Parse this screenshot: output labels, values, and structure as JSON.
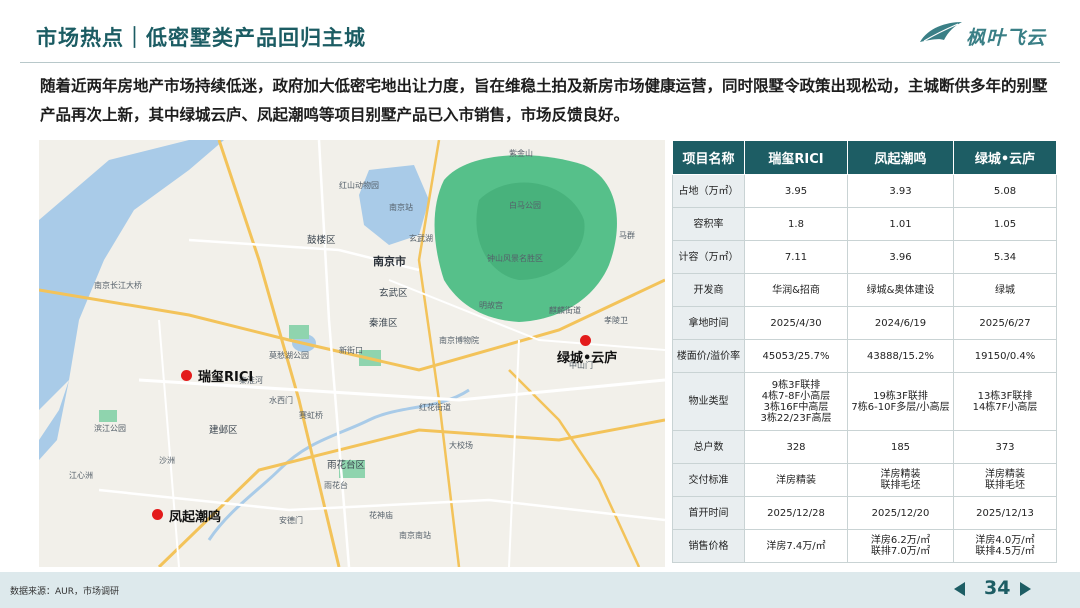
{
  "header": {
    "title": "市场热点｜低密墅类产品回归主城",
    "logo_text": "枫叶飞云"
  },
  "intro": {
    "text": "随着近两年房地产市场持续低迷，政府加大低密宅地出让力度，旨在维稳土拍及新房市场健康运营，同时限墅令政策出现松动，主城断供多年的别墅产品再次上新，其中绿城云庐、凤起潮鸣等项目别墅产品已入市销售，市场反馈良好。"
  },
  "map": {
    "pins": [
      {
        "label": "瑞玺RICI"
      },
      {
        "label": "绿城•云庐"
      },
      {
        "label": "凤起潮鸣"
      }
    ],
    "labels": {
      "nanjing_city": "南京市",
      "gulou": "鼓楼区",
      "xuanwu": "玄武区",
      "qinhuai": "秦淮区",
      "jianye": "建邺区",
      "yuhuatai": "雨花台区",
      "zhongshan": "钟山风景名胜区",
      "nanjing_station": "南京站",
      "nanjing_museum": "南京博物院",
      "xuanwu_lake": "玄武湖",
      "qixia": "麒麟街道",
      "hexi": "滨江公园",
      "zhongshan_gate": "中山门",
      "yuhua_park": "雨花台",
      "nanjing_south": "南京南站",
      "changjiang_bridge": "南京长江大桥",
      "mochou": "莫愁湖公园",
      "zijin": "紫金山",
      "ming_palace": "明故宫",
      "xinjiekou": "新街口",
      "ruanjian": "红花街道",
      "dajiaochang": "大校场",
      "jiangxinzhou": "江心洲",
      "qinhuai_river": "秦淮河",
      "baima": "白马公园",
      "hongshan": "红山动物园",
      "shuiximen": "水西门",
      "xiaolingwei": "孝陵卫",
      "maqun": "马群",
      "shazhou": "沙洲",
      "andemen": "安德门",
      "saihongqiao": "赛虹桥",
      "huashen": "花神庙"
    }
  },
  "table": {
    "header": [
      "项目名称",
      "瑞玺RICI",
      "凤起潮鸣",
      "绿城•云庐"
    ],
    "rows": [
      {
        "label": "占地（万㎡）",
        "cells": [
          [
            "3.95"
          ],
          [
            "3.93"
          ],
          [
            "5.08"
          ]
        ]
      },
      {
        "label": "容积率",
        "cells": [
          [
            "1.8"
          ],
          [
            "1.01"
          ],
          [
            "1.05"
          ]
        ]
      },
      {
        "label": "计容（万㎡）",
        "cells": [
          [
            "7.11"
          ],
          [
            "3.96"
          ],
          [
            "5.34"
          ]
        ]
      },
      {
        "label": "开发商",
        "cells": [
          [
            "华润&招商"
          ],
          [
            "绿城&奥体建设"
          ],
          [
            "绿城"
          ]
        ]
      },
      {
        "label": "拿地时间",
        "cells": [
          [
            "2025/4/30"
          ],
          [
            "2024/6/19"
          ],
          [
            "2025/6/27"
          ]
        ]
      },
      {
        "label": "楼面价/溢价率",
        "cells": [
          [
            "45053/25.7%"
          ],
          [
            "43888/15.2%"
          ],
          [
            "19150/0.4%"
          ]
        ]
      },
      {
        "label": "物业类型",
        "cells": [
          [
            "9栋3F联排",
            "4栋7-8F小高层",
            "3栋16F中高层",
            "3栋22/23F高层"
          ],
          [
            "19栋3F联排",
            "7栋6-10F多层/小高层"
          ],
          [
            "13栋3F联排",
            "14栋7F小高层"
          ]
        ]
      },
      {
        "label": "总户数",
        "cells": [
          [
            "328"
          ],
          [
            "185"
          ],
          [
            "373"
          ]
        ]
      },
      {
        "label": "交付标准",
        "cells": [
          [
            "洋房精装"
          ],
          [
            "洋房精装",
            "联排毛坯"
          ],
          [
            "洋房精装",
            "联排毛坯"
          ]
        ]
      },
      {
        "label": "首开时间",
        "cells": [
          [
            "2025/12/28"
          ],
          [
            "2025/12/20"
          ],
          [
            "2025/12/13"
          ]
        ]
      },
      {
        "label": "销售价格",
        "cells": [
          [
            "洋房7.4万/㎡"
          ],
          [
            "洋房6.2万/㎡",
            "联排7.0万/㎡"
          ],
          [
            "洋房4.0万/㎡",
            "联排4.5万/㎡"
          ]
        ]
      }
    ]
  },
  "footer": {
    "source": "数据来源：AUR，市场调研",
    "page": "34"
  },
  "colors": {
    "accent": "#1d5d64",
    "pin": "#e31b1b",
    "park": "#56c08a",
    "water": "#a9cbe8"
  }
}
